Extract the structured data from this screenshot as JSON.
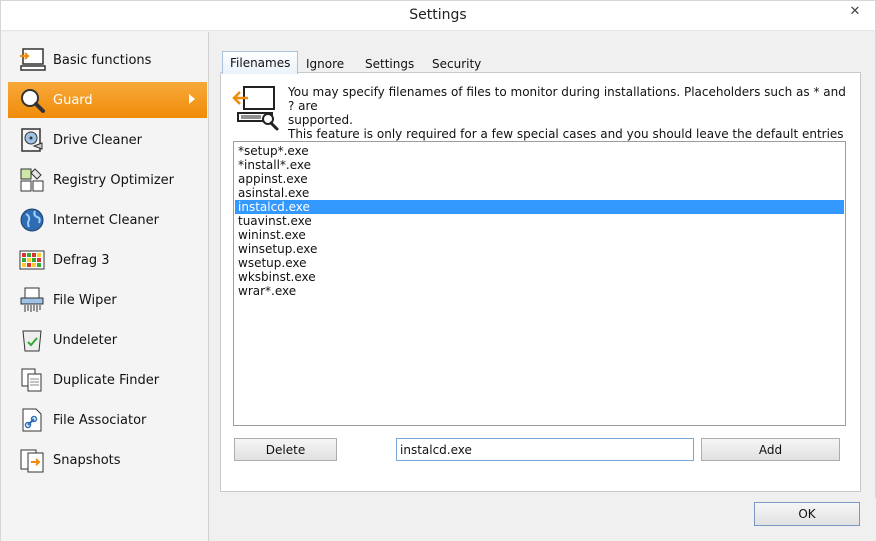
{
  "window": {
    "title": "Settings",
    "close_glyph": "✕"
  },
  "sidebar": {
    "items": [
      {
        "label": "Basic functions",
        "icon": "basic-functions-icon"
      },
      {
        "label": "Guard",
        "icon": "guard-magnifier-icon",
        "active": true
      },
      {
        "label": "Drive Cleaner",
        "icon": "drive-cleaner-icon"
      },
      {
        "label": "Registry Optimizer",
        "icon": "registry-optimizer-icon"
      },
      {
        "label": "Internet Cleaner",
        "icon": "globe-icon"
      },
      {
        "label": "Defrag 3",
        "icon": "defrag-icon"
      },
      {
        "label": "File Wiper",
        "icon": "shredder-icon"
      },
      {
        "label": "Undeleter",
        "icon": "recycle-bin-icon"
      },
      {
        "label": "Duplicate Finder",
        "icon": "duplicate-files-icon"
      },
      {
        "label": "File Associator",
        "icon": "file-link-icon"
      },
      {
        "label": "Snapshots",
        "icon": "snapshots-icon"
      }
    ]
  },
  "tabs": [
    {
      "label": "Filenames",
      "active": true
    },
    {
      "label": "Ignore"
    },
    {
      "label": "Settings"
    },
    {
      "label": "Security"
    }
  ],
  "info": {
    "line1": "You may specify filenames of files to monitor during installations. Placeholders such as * and ? are",
    "line2": "supported.",
    "line3": "This feature is only required for a few special cases and you should leave the default entries"
  },
  "filenames": [
    "*setup*.exe",
    "*install*.exe",
    "appinst.exe",
    "asinstal.exe",
    "instalcd.exe",
    "tuavinst.exe",
    "wininst.exe",
    "winsetup.exe",
    "wsetup.exe",
    "wksbinst.exe",
    "wrar*.exe"
  ],
  "selected_index": 4,
  "controls": {
    "delete_label": "Delete",
    "input_value": "instalcd.exe",
    "add_label": "Add",
    "ok_label": "OK"
  },
  "colors": {
    "accent": "#f39a1f",
    "selection": "#3399ff"
  }
}
